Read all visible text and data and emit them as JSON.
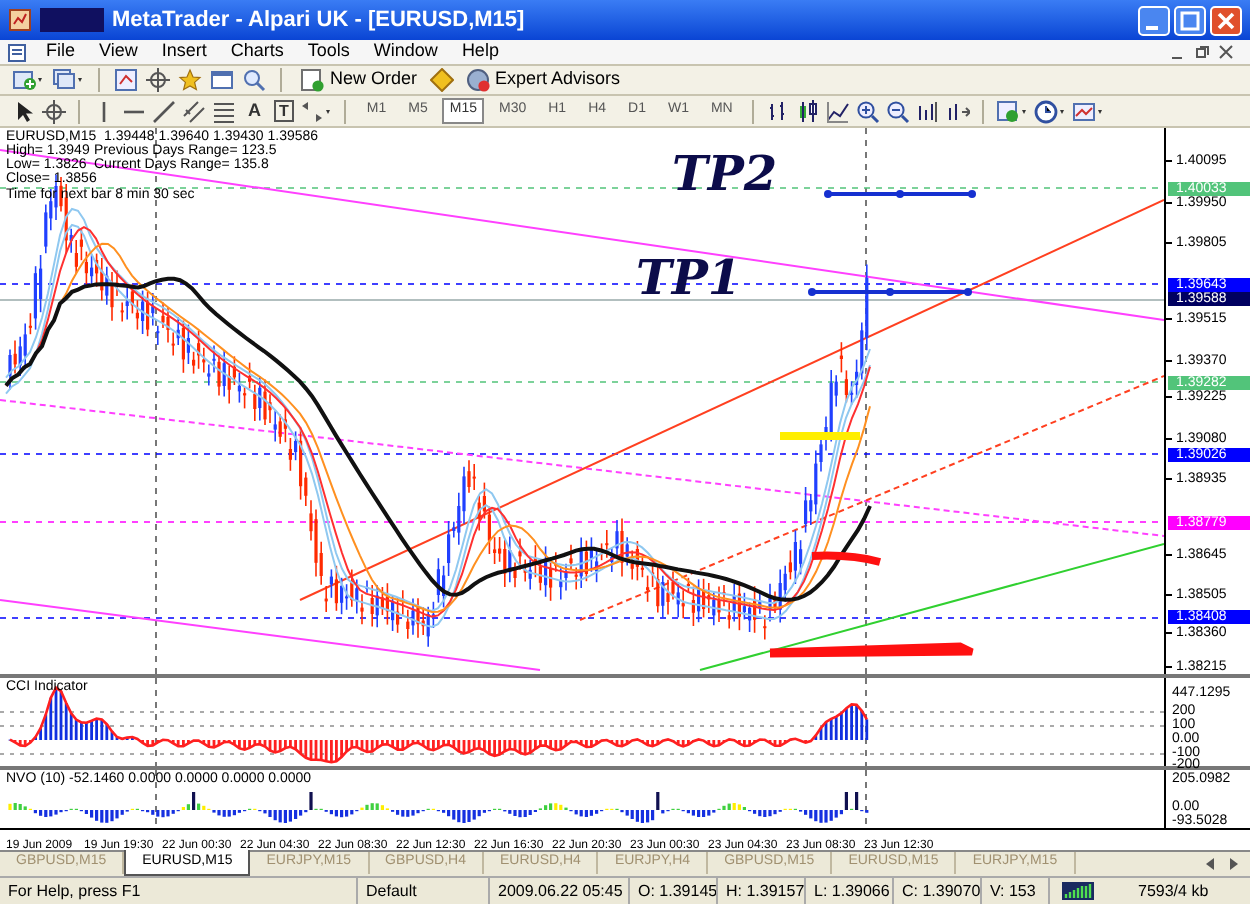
{
  "window": {
    "title": "MetaTrader - Alpari UK - [EURUSD,M15]"
  },
  "menu": [
    "File",
    "View",
    "Insert",
    "Charts",
    "Tools",
    "Window",
    "Help"
  ],
  "toolbar": {
    "new_order": "New Order",
    "expert_advisors": "Expert Advisors",
    "text_tool": "A",
    "label_tool": "T",
    "periods": [
      {
        "label": "M1",
        "selected": false
      },
      {
        "label": "M5",
        "selected": false
      },
      {
        "label": "M15",
        "selected": true
      },
      {
        "label": "M30",
        "selected": false
      },
      {
        "label": "H1",
        "selected": false
      },
      {
        "label": "H4",
        "selected": false
      },
      {
        "label": "D1",
        "selected": false
      },
      {
        "label": "W1",
        "selected": false
      },
      {
        "label": "MN",
        "selected": false
      }
    ]
  },
  "chart": {
    "symbol_line": "EURUSD,M15  1.39448 1.39640 1.39430 1.39586",
    "info_rows": [
      [
        "High= 1.3949",
        "Previous Days Range= 123.5"
      ],
      [
        "Low= 1.3826",
        "Current Days Range= 135.8"
      ],
      [
        "Close= 1.3856"
      ]
    ],
    "timer": "Time for next bar 8 min 30 sec",
    "annotations": [
      "TP2",
      "TP1"
    ],
    "price_axis": [
      "1.40095",
      "1.39950",
      "1.39805",
      "1.39515",
      "1.39370",
      "1.39225",
      "1.39080",
      "1.38935",
      "1.38645",
      "1.38505",
      "1.38360",
      "1.38215"
    ],
    "price_tags": [
      {
        "text": "1.40033",
        "color": "#52c47a"
      },
      {
        "text": "1.39643",
        "color": "#0000ff"
      },
      {
        "text": "1.39588",
        "color": "#000060"
      },
      {
        "text": "1.39282",
        "color": "#52c47a"
      },
      {
        "text": "1.39026",
        "color": "#0000ff"
      },
      {
        "text": "1.38779",
        "color": "#ff00ff"
      },
      {
        "text": "1.38408",
        "color": "#0000ff"
      }
    ],
    "cci": {
      "title": "CCI Indicator",
      "axis": [
        "447.1295",
        "200",
        "100",
        "0.00",
        "-100",
        "-200"
      ]
    },
    "nvo": {
      "title": "NVO (10) -52.1460 0.0000 0.0000 0.0000 0.0000",
      "axis": [
        "205.0982",
        "0.00",
        "-93.5028"
      ]
    },
    "time_axis": [
      "19 Jun 2009",
      "19 Jun 19:30",
      "22 Jun 00:30",
      "22 Jun 04:30",
      "22 Jun 08:30",
      "22 Jun 12:30",
      "22 Jun 16:30",
      "22 Jun 20:30",
      "23 Jun 00:30",
      "23 Jun 04:30",
      "23 Jun 08:30",
      "23 Jun 12:30"
    ]
  },
  "tabs": [
    {
      "label": "GBPUSD,M15",
      "selected": false
    },
    {
      "label": "EURUSD,M15",
      "selected": true
    },
    {
      "label": "EURJPY,M15",
      "selected": false
    },
    {
      "label": "GBPUSD,H4",
      "selected": false
    },
    {
      "label": "EURUSD,H4",
      "selected": false
    },
    {
      "label": "EURJPY,H4",
      "selected": false
    },
    {
      "label": "GBPUSD,M15",
      "selected": false
    },
    {
      "label": "EURUSD,M15",
      "selected": false
    },
    {
      "label": "EURJPY,M15",
      "selected": false
    }
  ],
  "status_bar": [
    "For Help, press F1",
    "Default",
    "2009.06.22 05:45",
    "O: 1.39145",
    "H: 1.39157",
    "L: 1.39066",
    "C: 1.39070",
    "V: 153",
    "7593/4 kb"
  ]
}
